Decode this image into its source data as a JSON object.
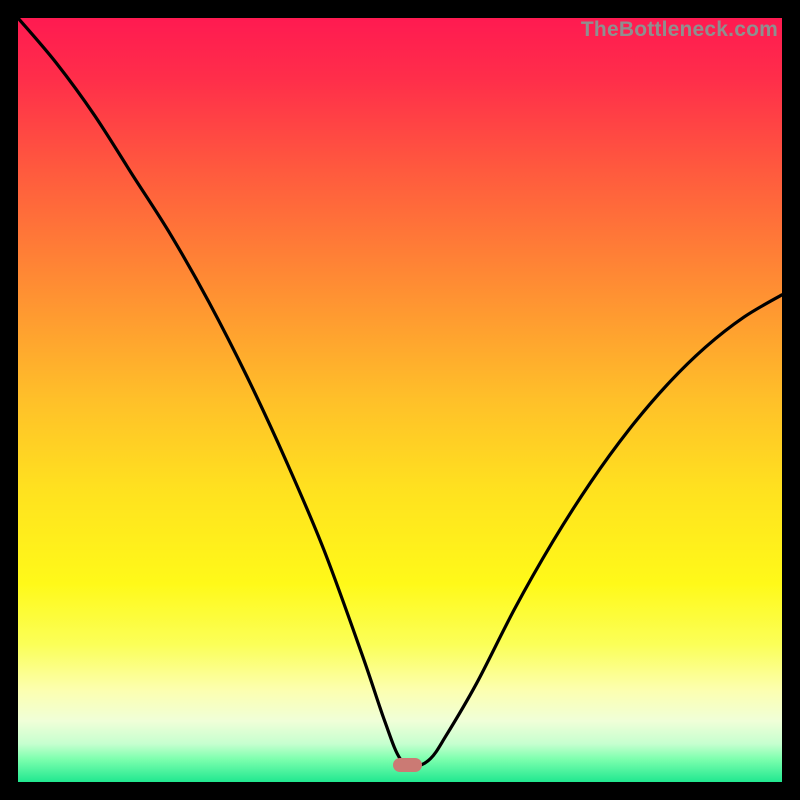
{
  "attribution": "TheBottleneck.com",
  "colors": {
    "frame": "#000000",
    "curve": "#000000",
    "marker": "#cb7a74",
    "gradient_stops": [
      {
        "pct": 0,
        "color": "#ff1a51"
      },
      {
        "pct": 8,
        "color": "#ff2e4a"
      },
      {
        "pct": 20,
        "color": "#ff5a3e"
      },
      {
        "pct": 35,
        "color": "#ff8d33"
      },
      {
        "pct": 50,
        "color": "#ffc029"
      },
      {
        "pct": 62,
        "color": "#ffe21f"
      },
      {
        "pct": 74,
        "color": "#fff919"
      },
      {
        "pct": 82,
        "color": "#fbff58"
      },
      {
        "pct": 88,
        "color": "#fcffb0"
      },
      {
        "pct": 92,
        "color": "#f0ffd8"
      },
      {
        "pct": 95,
        "color": "#c6ffcf"
      },
      {
        "pct": 97,
        "color": "#7dffae"
      },
      {
        "pct": 100,
        "color": "#21e890"
      }
    ]
  },
  "marker": {
    "x_pct": 51.0,
    "width_pct": 3.8
  },
  "chart_data": {
    "type": "line",
    "title": "",
    "xlabel": "",
    "ylabel": "",
    "xlim": [
      0,
      100
    ],
    "ylim": [
      0,
      100
    ],
    "grid": false,
    "legend": false,
    "series": [
      {
        "name": "bottleneck-curve",
        "x": [
          0,
          5,
          10,
          15,
          20,
          25,
          30,
          35,
          40,
          45,
          48,
          50,
          52,
          54,
          56,
          60,
          65,
          70,
          75,
          80,
          85,
          90,
          95,
          100
        ],
        "values": [
          100,
          94,
          87,
          79,
          71,
          62,
          52,
          41,
          29,
          15,
          6,
          1,
          0,
          1,
          4,
          11,
          21,
          30,
          38,
          45,
          51,
          56,
          60,
          63
        ]
      }
    ],
    "annotations": [
      {
        "text": "TheBottleneck.com",
        "position": "top-right"
      }
    ],
    "optimal_x": 52
  }
}
